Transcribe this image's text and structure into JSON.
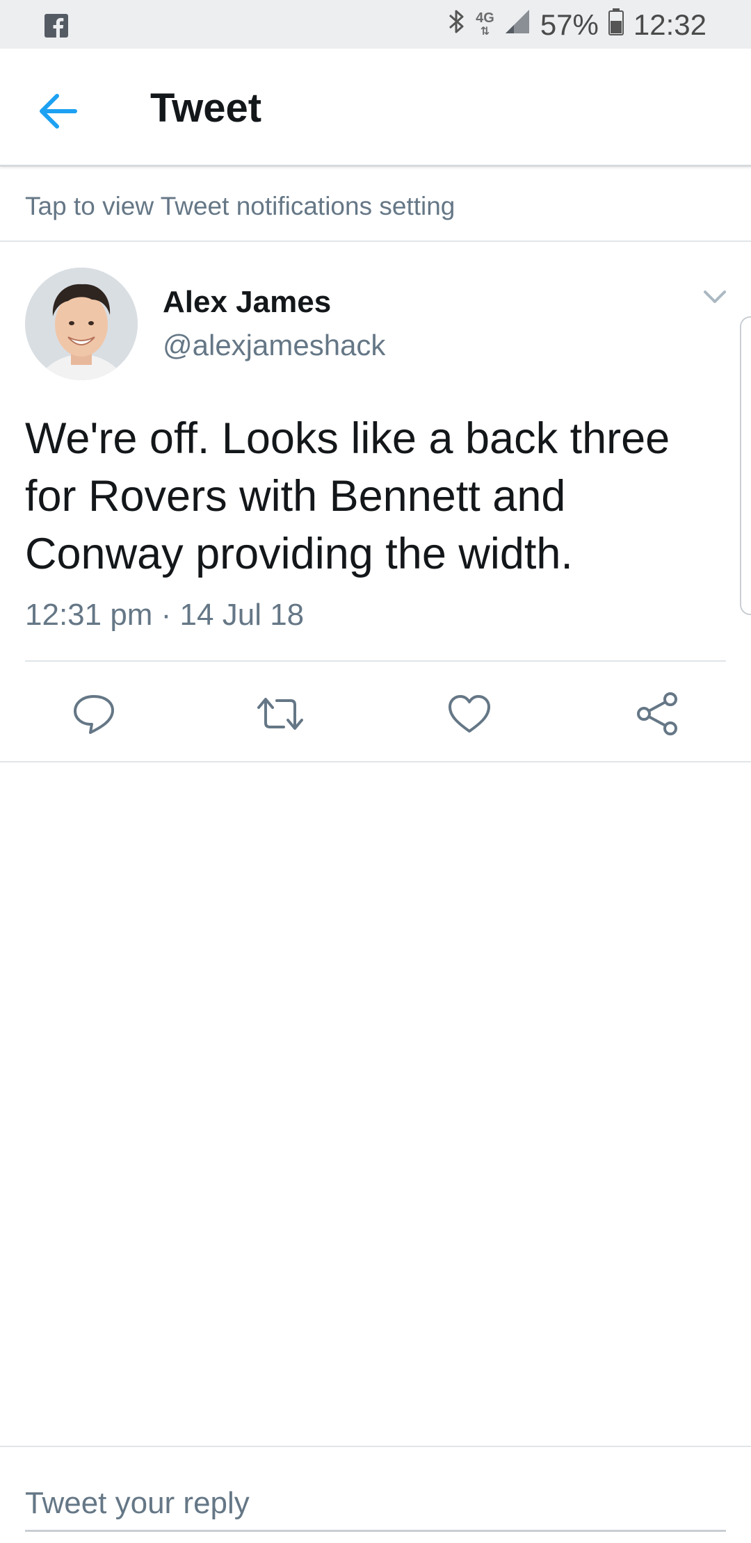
{
  "status_bar": {
    "app_icon": "facebook-icon",
    "network": "4G",
    "battery": "57%",
    "time": "12:32"
  },
  "header": {
    "back_icon": "arrow-left-icon",
    "title": "Tweet"
  },
  "notification_banner": {
    "text": "Tap to view Tweet notifications setting"
  },
  "tweet": {
    "author": {
      "name": "Alex James",
      "handle": "@alexjameshack"
    },
    "text": "We're off. Looks like a back three for Rovers with Bennett and Conway providing the width.",
    "timestamp": "12:31 pm · 14 Jul 18",
    "actions": [
      "reply-icon",
      "retweet-icon",
      "like-icon",
      "share-icon"
    ]
  },
  "reply": {
    "placeholder": "Tweet your reply"
  },
  "colors": {
    "accent": "#1da1f2",
    "text_primary": "#14171a",
    "text_secondary": "#657786",
    "divider": "#e1e5e8"
  }
}
